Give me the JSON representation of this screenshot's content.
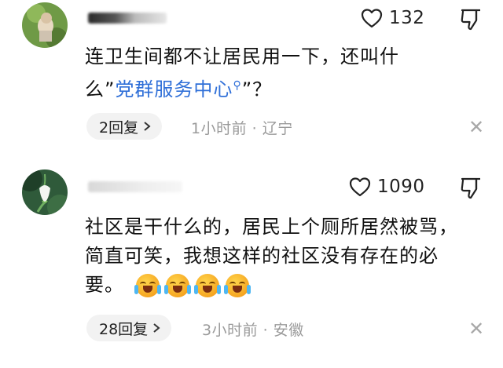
{
  "comments": [
    {
      "avatar_icon": "avatar-photo-green",
      "like_count": "132",
      "text_parts": [
        "连卫生间都不让居民用一下，还叫什",
        "么”",
        "党群服务中心",
        "”？"
      ],
      "link_icon": "search-icon",
      "reply_label": "2回复",
      "time": "1小时前 · 辽宁"
    },
    {
      "avatar_icon": "avatar-snowdrop-flower",
      "like_count": "1090",
      "text": "社区是干什么的，居民上个厕所居然被骂，简直可笑，我想这样的社区没有存在的必要。",
      "emoji_icon": "loudly-crying-emoji",
      "emoji_count": 4,
      "reply_label": "28回复",
      "time": "3小时前 · 安徽"
    }
  ],
  "colors": {
    "link": "#2f6fd8",
    "meta": "#9a9a9a",
    "reply_bg": "#f2f2f2"
  }
}
